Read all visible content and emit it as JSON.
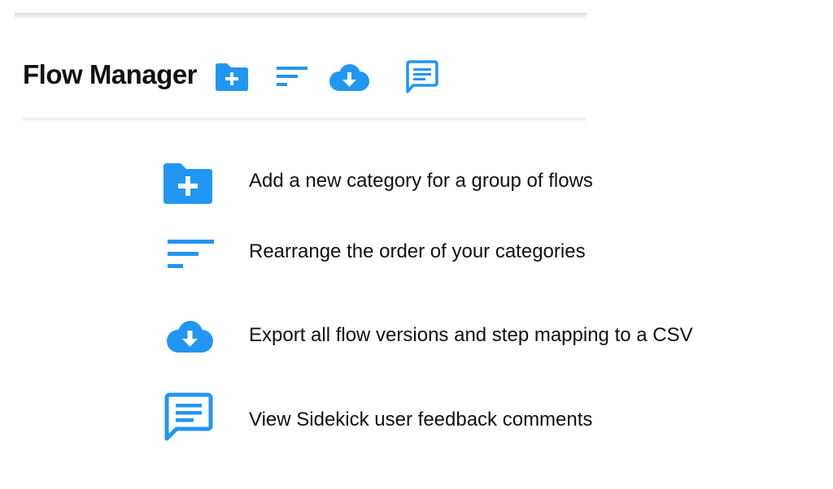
{
  "colors": {
    "accent": "#2196F3",
    "title": "#111111",
    "text": "#111111",
    "background": "#FFFFFF"
  },
  "header": {
    "title": "Flow Manager",
    "toolbar": [
      {
        "icon": "folder-plus-icon",
        "action": "add-category"
      },
      {
        "icon": "sort-icon",
        "action": "rearrange-categories"
      },
      {
        "icon": "cloud-download-icon",
        "action": "export-csv"
      },
      {
        "icon": "feedback-comment-icon",
        "action": "view-feedback"
      }
    ]
  },
  "legend": [
    {
      "icon": "folder-plus-icon",
      "text": "Add a new category for a group of flows"
    },
    {
      "icon": "sort-icon",
      "text": "Rearrange the order of your categories"
    },
    {
      "icon": "cloud-download-icon",
      "text": "Export all flow versions and step mapping to a CSV"
    },
    {
      "icon": "feedback-comment-icon",
      "text": "View Sidekick user feedback comments"
    }
  ]
}
